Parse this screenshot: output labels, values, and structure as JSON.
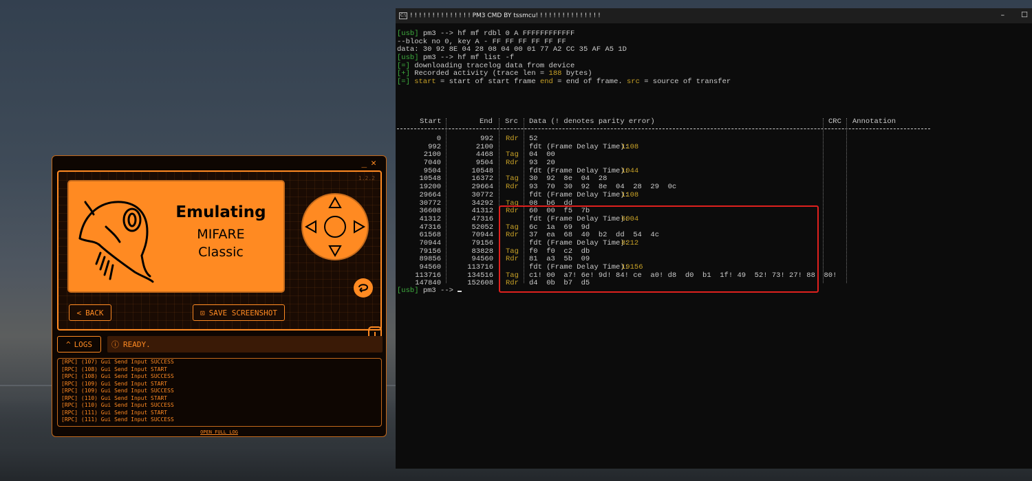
{
  "flipper": {
    "version": "1.2.2",
    "lcd_title": "Emulating",
    "lcd_line1": "MIFARE",
    "lcd_line2": "Classic",
    "back_label": "BACK",
    "screenshot_label": "SAVE SCREENSHOT",
    "logs_label": "LOGS",
    "status": "READY.",
    "log_lines": [
      "[RPC] (107) Gui Send Input SUCCESS",
      "[RPC] (108) Gui Send Input START",
      "[RPC] (108) Gui Send Input SUCCESS",
      "[RPC] (109) Gui Send Input START",
      "[RPC] (109) Gui Send Input SUCCESS",
      "[RPC] (110) Gui Send Input START",
      "[RPC] (110) Gui Send Input SUCCESS",
      "[RPC] (111) Gui Send Input START",
      "[RPC] (111) Gui Send Input SUCCESS"
    ],
    "open_full_log": "OPEN FULL LOG",
    "accent": "#ff8a22"
  },
  "console": {
    "title": "! ! ! ! ! ! ! ! ! ! ! ! ! ! PM3 CMD BY tssmcu! ! ! ! ! ! ! ! ! ! ! ! ! ! !",
    "lines": {
      "l1_tag": "[usb]",
      "l1_text": " pm3 --> hf mf rdbl 0 A FFFFFFFFFFFF",
      "l2": "--block no 0, key A - FF FF FF FF FF FF",
      "l3": "data: 30 92 8E 04 28 08 04 00 01 77 A2 CC 35 AF A5 1D",
      "l4_tag": "[usb]",
      "l4_text": " pm3 --> hf mf list -f",
      "l5_tag": "[=]",
      "l5_text": " downloading tracelog data from device",
      "l6_tag": "[+]",
      "l6_pre": " Recorded activity (trace len = ",
      "l6_num": "188",
      "l6_post": " bytes)",
      "l7_tag": "[=]",
      "l7_a": " start",
      "l7_b": " = start of start frame ",
      "l7_c": "end",
      "l7_d": " = end of frame. ",
      "l7_e": "src",
      "l7_f": " = source of transfer"
    },
    "headers": {
      "start": "Start",
      "end": "End",
      "src": "Src",
      "data": "Data (! denotes parity error)",
      "crc": "CRC",
      "annotation": "Annotation"
    },
    "rows": [
      {
        "start": "0",
        "end": "992",
        "src": "Rdr",
        "data": "52"
      },
      {
        "start": "992",
        "end": "2100",
        "src": "",
        "data": "fdt (Frame Delay Time): ",
        "fdt": "1108"
      },
      {
        "start": "2100",
        "end": "4468",
        "src": "Tag",
        "data": "04  00"
      },
      {
        "start": "7040",
        "end": "9504",
        "src": "Rdr",
        "data": "93  20"
      },
      {
        "start": "9504",
        "end": "10548",
        "src": "",
        "data": "fdt (Frame Delay Time): ",
        "fdt": "1044"
      },
      {
        "start": "10548",
        "end": "16372",
        "src": "Tag",
        "data": "30  92  8e  04  28"
      },
      {
        "start": "19200",
        "end": "29664",
        "src": "Rdr",
        "data": "93  70  30  92  8e  04  28  29  0c"
      },
      {
        "start": "29664",
        "end": "30772",
        "src": "",
        "data": "fdt (Frame Delay Time): ",
        "fdt": "1108"
      },
      {
        "start": "30772",
        "end": "34292",
        "src": "Tag",
        "data": "08  b6  dd"
      },
      {
        "start": "36608",
        "end": "41312",
        "src": "Rdr",
        "data": "60  00  f5  7b"
      },
      {
        "start": "41312",
        "end": "47316",
        "src": "",
        "data": "fdt (Frame Delay Time): ",
        "fdt": "6004"
      },
      {
        "start": "47316",
        "end": "52052",
        "src": "Tag",
        "data": "6c  1a  69  9d"
      },
      {
        "start": "61568",
        "end": "70944",
        "src": "Rdr",
        "data": "37  ea  68  40  b2  dd  54  4c"
      },
      {
        "start": "70944",
        "end": "79156",
        "src": "",
        "data": "fdt (Frame Delay Time): ",
        "fdt": "8212"
      },
      {
        "start": "79156",
        "end": "83828",
        "src": "Tag",
        "data": "f0  f0  c2  db"
      },
      {
        "start": "89856",
        "end": "94560",
        "src": "Rdr",
        "data": "81  a3  5b  09"
      },
      {
        "start": "94560",
        "end": "113716",
        "src": "",
        "data": "fdt (Frame Delay Time): ",
        "fdt": "19156"
      },
      {
        "start": "113716",
        "end": "134516",
        "src": "Tag",
        "data": "c1! 00  a7! 6e! 9d! 84! ce  a0! d8  d0  b1  1f! 49  52! 73! 27! 88  80!"
      },
      {
        "start": "147840",
        "end": "152608",
        "src": "Rdr",
        "data": "d4  0b  b7  d5"
      }
    ],
    "prompt_tag": "[usb]",
    "prompt_text": " pm3 --> ",
    "colors": {
      "tag": "#3fae3f",
      "highlight": "#c9a227",
      "box": "#e0211e"
    }
  }
}
